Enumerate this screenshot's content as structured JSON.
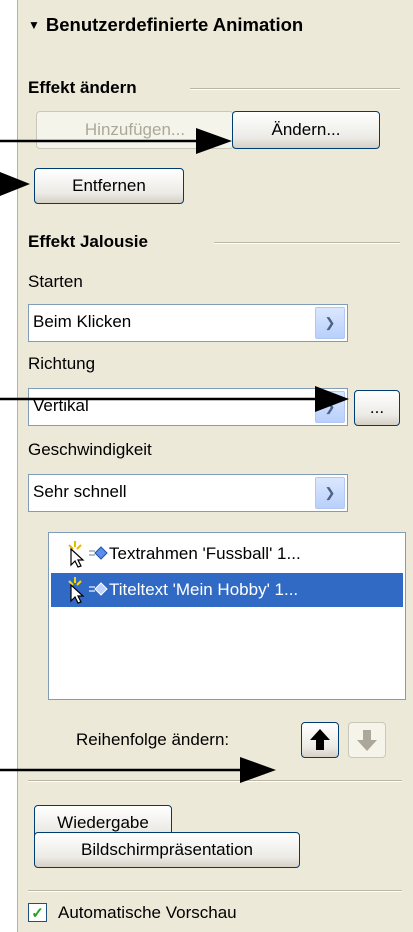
{
  "panel": {
    "title": "Benutzerdefinierte Animation",
    "section_change": "Effekt ändern",
    "btn_add": "Hinzufügen...",
    "btn_change": "Ändern...",
    "btn_remove": "Entfernen",
    "section_effect": "Effekt Jalousie",
    "label_start": "Starten",
    "start_value": "Beim Klicken",
    "label_direction": "Richtung",
    "direction_value": "Vertikal",
    "btn_more": "...",
    "label_speed": "Geschwindigkeit",
    "speed_value": "Sehr schnell",
    "list_items": [
      {
        "text": "Textrahmen 'Fussball' 1..."
      },
      {
        "text": "Titeltext 'Mein Hobby' 1..."
      }
    ],
    "label_order": "Reihenfolge ändern:",
    "btn_play": "Wiedergabe",
    "btn_slideshow": "Bildschirmpräsentation",
    "checkbox_preview": "Automatische Vorschau",
    "preview_checked": true
  },
  "icons": {
    "collapse": "collapse-triangle-icon",
    "dropdown": "chevron-down-icon",
    "cursor": "click-cursor-icon",
    "effect": "effect-diamond-icon",
    "up": "arrow-up-icon",
    "down": "arrow-down-icon",
    "check": "checkmark-icon"
  },
  "colors": {
    "panel_bg": "#ece9d8",
    "selection": "#316ac5",
    "button_border": "#003c74",
    "check": "#21a121"
  }
}
